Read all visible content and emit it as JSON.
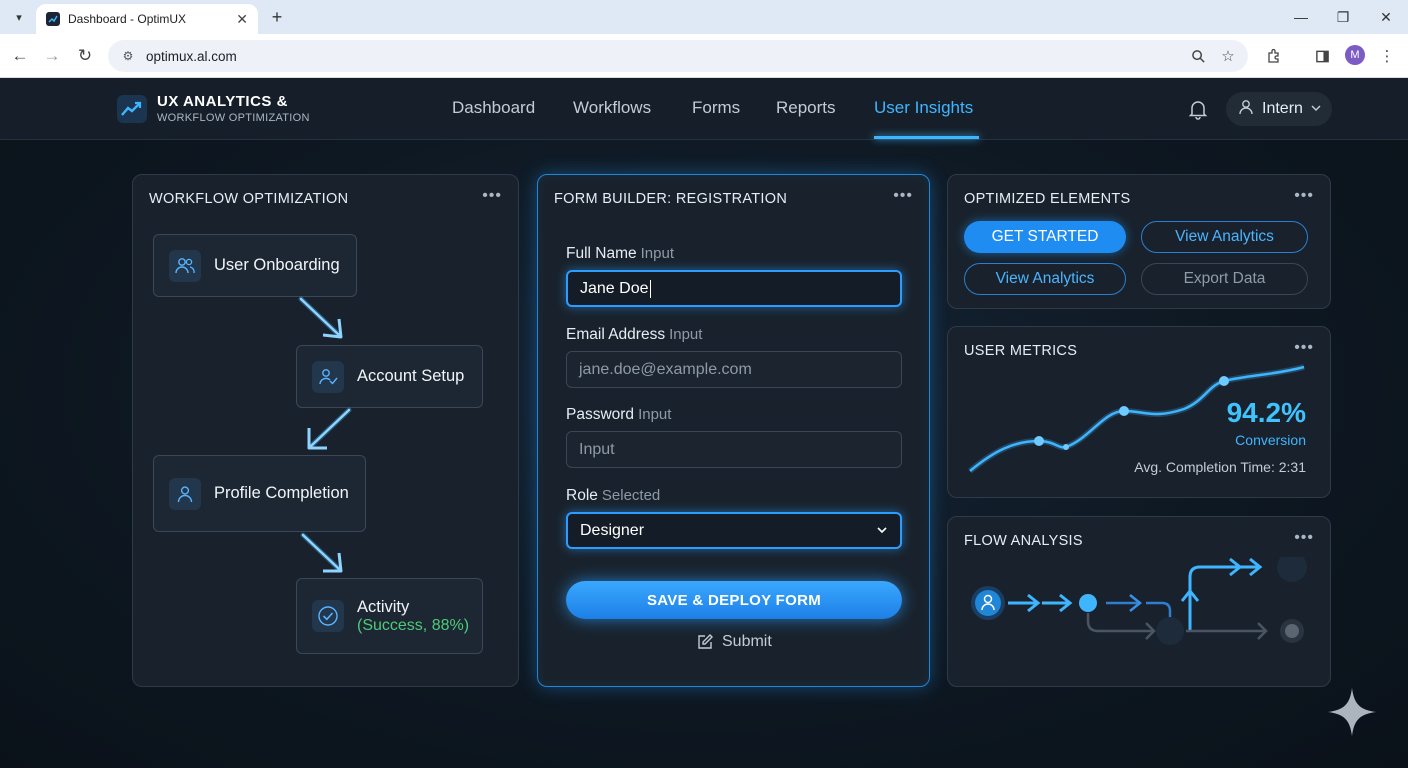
{
  "browser": {
    "tab_title": "Dashboard - OptimUX",
    "url": "optimux.al.com",
    "profile_initial": "M"
  },
  "header": {
    "brand_title": "UX ANALYTICS &",
    "brand_subtitle": "WORKFLOW OPTIMIZATION",
    "nav": [
      "Dashboard",
      "Workflows",
      "Forms",
      "Reports",
      "User Insights"
    ],
    "active_nav": "User Insights",
    "user": "Intern"
  },
  "workflow": {
    "title": "WORKFLOW OPTIMIZATION",
    "steps": [
      {
        "label": "User Onboarding",
        "icon": "users-icon"
      },
      {
        "label": "Account Setup",
        "icon": "user-check-icon"
      },
      {
        "label": "Profile Completion",
        "icon": "user-icon"
      },
      {
        "label": "Activity",
        "status": "(Success, 88%)",
        "icon": "check-circle-icon"
      }
    ]
  },
  "form": {
    "title": "FORM BUILDER: REGISTRATION",
    "fields": [
      {
        "label": "Full Name",
        "hint": "Input",
        "value": "Jane Doe"
      },
      {
        "label": "Email Address",
        "hint": "Input",
        "value": "jane.doe@example.com"
      },
      {
        "label": "Password",
        "hint": "Input",
        "value": "Input"
      },
      {
        "label": "Role",
        "hint": "Selected",
        "value": "Designer"
      }
    ],
    "deploy_label": "SAVE & DEPLOY FORM",
    "submit_label": "Submit"
  },
  "optimized": {
    "title": "OPTIMIZED ELEMENTS",
    "buttons": [
      "GET STARTED",
      "View Analytics",
      "View Analytics",
      "Export Data"
    ]
  },
  "metrics": {
    "title": "USER METRICS",
    "value": "94.2%",
    "value_label": "Conversion",
    "completion": "Avg. Completion Time: 2:31"
  },
  "flow": {
    "title": "FLOW ANALYSIS"
  },
  "colors": {
    "accent": "#3fb5ff",
    "success": "#4ecb78",
    "card_bg": "#19222c"
  }
}
